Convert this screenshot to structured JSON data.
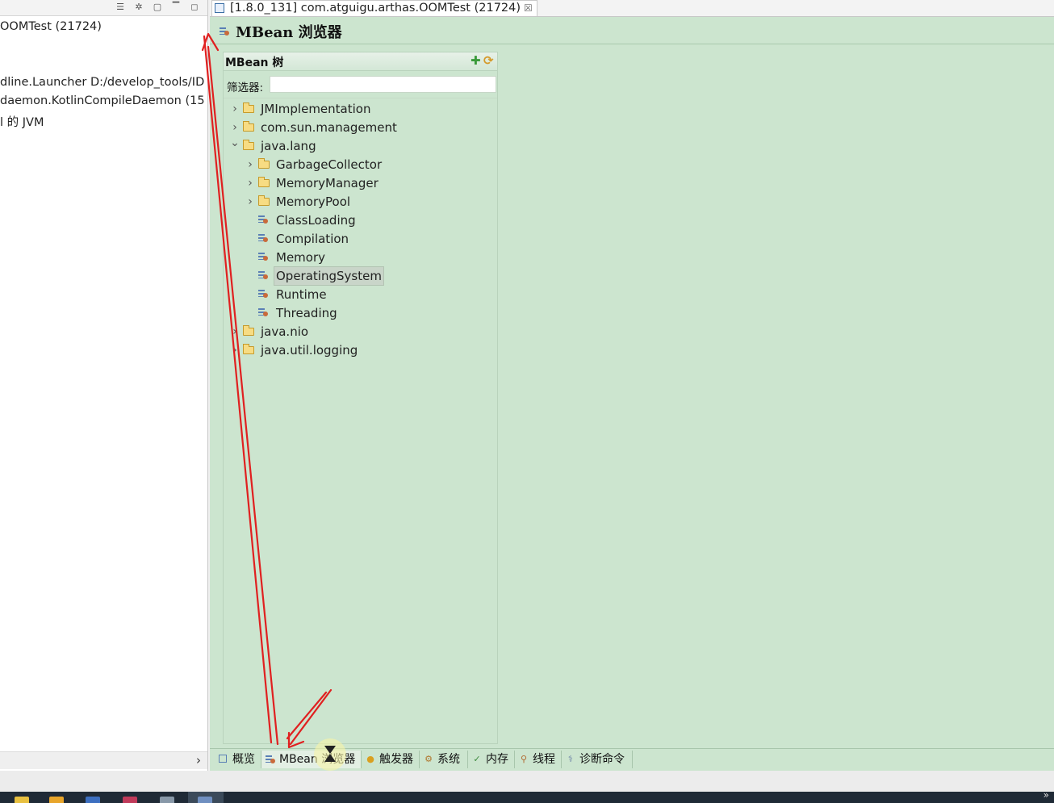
{
  "left_panel": {
    "items": [
      "OOMTest (21724)",
      "dline.Launcher D:/develop_tools/ID",
      "daemon.KotlinCompileDaemon (15",
      "l 的 JVM"
    ],
    "scroll_glyph": "›"
  },
  "editor_tab": {
    "title": "[1.8.0_131] com.atguigu.arthas.OOMTest (21724)",
    "close_glyph": "☒"
  },
  "page": {
    "title": "MBean 浏览器",
    "icon": "mbean-icon"
  },
  "tree_section": {
    "title": "MBean 树",
    "filter_label": "筛选器:",
    "filter_value": "",
    "actions": [
      "add-icon",
      "refresh-icon"
    ]
  },
  "tree": [
    {
      "label": "JMImplementation",
      "type": "folder",
      "level": 0,
      "expanded": false
    },
    {
      "label": "com.sun.management",
      "type": "folder",
      "level": 0,
      "expanded": false
    },
    {
      "label": "java.lang",
      "type": "folder",
      "level": 0,
      "expanded": true
    },
    {
      "label": "GarbageCollector",
      "type": "folder",
      "level": 1,
      "expanded": false
    },
    {
      "label": "MemoryManager",
      "type": "folder",
      "level": 1,
      "expanded": false
    },
    {
      "label": "MemoryPool",
      "type": "folder",
      "level": 1,
      "expanded": false
    },
    {
      "label": "ClassLoading",
      "type": "bean",
      "level": 1
    },
    {
      "label": "Compilation",
      "type": "bean",
      "level": 1
    },
    {
      "label": "Memory",
      "type": "bean",
      "level": 1
    },
    {
      "label": "OperatingSystem",
      "type": "bean",
      "level": 1,
      "selected": true
    },
    {
      "label": "Runtime",
      "type": "bean",
      "level": 1
    },
    {
      "label": "Threading",
      "type": "bean",
      "level": 1
    },
    {
      "label": "java.nio",
      "type": "folder",
      "level": 0,
      "expanded": false
    },
    {
      "label": "java.util.logging",
      "type": "folder",
      "level": 0,
      "expanded": false
    }
  ],
  "bottom_tabs": [
    {
      "label": "概览",
      "icon": "overview-icon",
      "active": false
    },
    {
      "label": "MBean 浏览器",
      "icon": "mbean-icon",
      "active": true
    },
    {
      "label": "触发器",
      "icon": "trigger-icon",
      "active": false
    },
    {
      "label": "系统",
      "icon": "system-icon",
      "active": false
    },
    {
      "label": "内存",
      "icon": "memory-icon",
      "active": false
    },
    {
      "label": "线程",
      "icon": "thread-icon",
      "active": false
    },
    {
      "label": "诊断命令",
      "icon": "diagnostic-icon",
      "active": false
    }
  ],
  "colors": {
    "editor_bg": "#cce5cf",
    "annotation_arrow": "#e02020",
    "selection": "#c9d5c9"
  }
}
